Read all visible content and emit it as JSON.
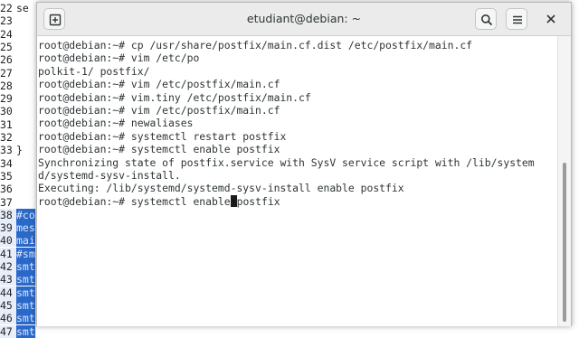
{
  "background_editor": {
    "top_fragment": "se",
    "lines": [
      {
        "num": "22",
        "frag": "se"
      },
      {
        "num": "23",
        "frag": ""
      },
      {
        "num": "24",
        "frag": ""
      },
      {
        "num": "25",
        "frag": ""
      },
      {
        "num": "26",
        "frag": ""
      },
      {
        "num": "27",
        "frag": ""
      },
      {
        "num": "28",
        "frag": ""
      },
      {
        "num": "29",
        "frag": ""
      },
      {
        "num": "30",
        "frag": ""
      },
      {
        "num": "31",
        "frag": ""
      },
      {
        "num": "32",
        "frag": ""
      },
      {
        "num": "33",
        "frag": "}"
      },
      {
        "num": "34",
        "frag": ""
      },
      {
        "num": "35",
        "frag": ""
      },
      {
        "num": "36",
        "frag": ""
      },
      {
        "num": "37",
        "frag": ""
      },
      {
        "num": "38",
        "frag": "#co"
      },
      {
        "num": "39",
        "frag": "mes"
      },
      {
        "num": "40",
        "frag": "mai"
      },
      {
        "num": "41",
        "frag": "#sm"
      },
      {
        "num": "42",
        "frag": "smt"
      },
      {
        "num": "43",
        "frag": "smt"
      },
      {
        "num": "44",
        "frag": "smt"
      },
      {
        "num": "45",
        "frag": "smt"
      },
      {
        "num": "46",
        "frag": "smt"
      },
      {
        "num": "47",
        "frag": "smt"
      }
    ]
  },
  "terminal": {
    "title": "etudiant@debian: ~",
    "new_tab_icon": "new-tab-icon",
    "search_icon": "search-icon",
    "menu_icon": "hamburger-menu-icon",
    "close_icon": "close-icon",
    "lines": [
      "root@debian:~# cp /usr/share/postfix/main.cf.dist /etc/postfix/main.cf",
      "root@debian:~# vim /etc/po",
      "polkit-1/ postfix/",
      "root@debian:~# vim /etc/postfix/main.cf",
      "root@debian:~# vim.tiny /etc/postfix/main.cf",
      "root@debian:~# vim /etc/postfix/main.cf",
      "root@debian:~# newaliases",
      "root@debian:~# systemctl restart postfix",
      "root@debian:~# systemctl enable postfix",
      "Synchronizing state of postfix.service with SysV service script with /lib/system",
      "d/systemd-sysv-install.",
      "Executing: /lib/systemd/systemd-sysv-install enable postfix"
    ],
    "prompt_line": {
      "before_cursor": "root@debian:~# systemctl enable",
      "after_cursor": "postfix"
    }
  }
}
